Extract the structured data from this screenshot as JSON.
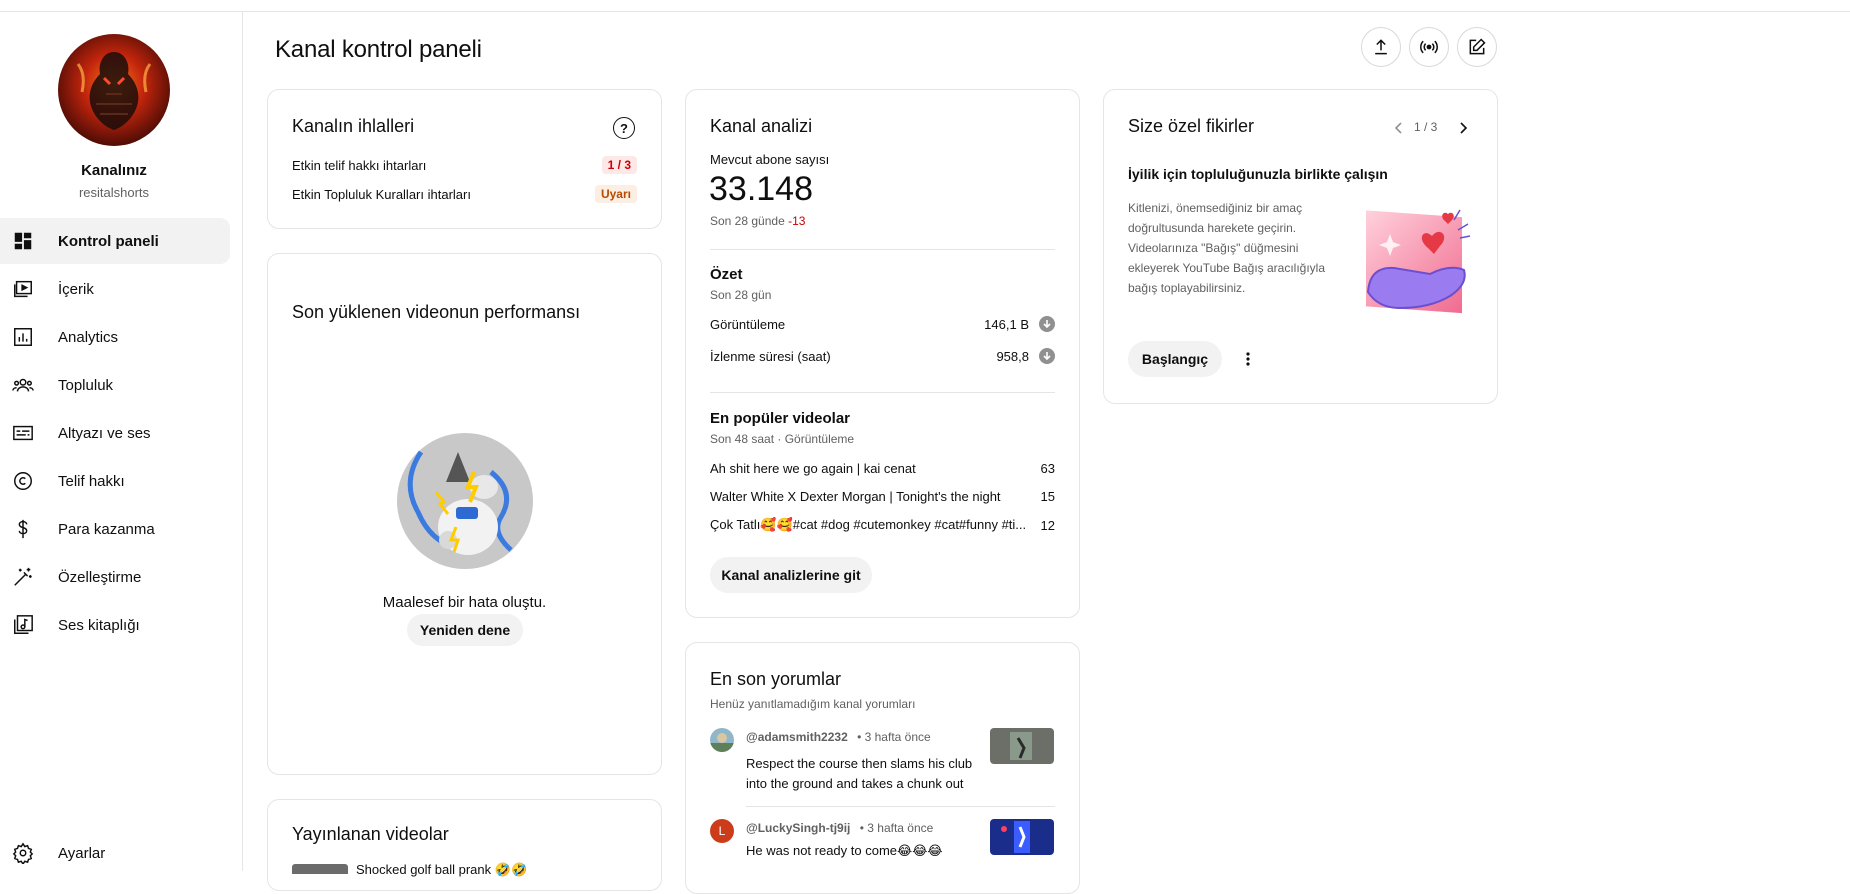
{
  "colors": {
    "red_text": "#cc0000",
    "badge_red_bg": "#fde8e8",
    "badge_orange_bg": "#fdeee4",
    "badge_orange_text": "#b84a00",
    "accent_blue": "#065fd4"
  },
  "sidebar": {
    "channel_title": "Kanalınız",
    "channel_handle": "resitalshorts",
    "items": [
      {
        "label": "Kontrol paneli",
        "icon": "dashboard-icon",
        "active": true
      },
      {
        "label": "İçerik",
        "icon": "content-icon"
      },
      {
        "label": "Analytics",
        "icon": "analytics-icon"
      },
      {
        "label": "Topluluk",
        "icon": "community-icon"
      },
      {
        "label": "Altyazı ve ses",
        "icon": "subtitles-icon"
      },
      {
        "label": "Telif hakkı",
        "icon": "copyright-icon"
      },
      {
        "label": "Para kazanma",
        "icon": "monetization-icon"
      },
      {
        "label": "Özelleştirme",
        "icon": "customization-icon"
      },
      {
        "label": "Ses kitaplığı",
        "icon": "audio-library-icon"
      }
    ],
    "settings_label": "Ayarlar"
  },
  "header": {
    "title": "Kanal kontrol paneli",
    "buttons": [
      "upload-icon",
      "live-icon",
      "create-post-icon"
    ]
  },
  "violations": {
    "title": "Kanalın ihlalleri",
    "rows": [
      {
        "label": "Etkin telif hakkı ihtarları",
        "badge": "1 / 3"
      },
      {
        "label": "Etkin Topluluk Kuralları ihtarları",
        "badge": "Uyarı"
      }
    ]
  },
  "latest_video": {
    "title": "Son yüklenen videonun performansı",
    "error": "Maalesef bir hata oluştu.",
    "retry": "Yeniden dene"
  },
  "published": {
    "title": "Yayınlanan videolar",
    "first_video": "Shocked golf ball prank 🤣🤣"
  },
  "analytics": {
    "title": "Kanal analizi",
    "subscribers_label": "Mevcut abone sayısı",
    "subscribers": "33.148",
    "change_prefix": "Son 28 günde ",
    "change_value": "-13",
    "summary_title": "Özet",
    "summary_period": "Son 28 gün",
    "metrics": [
      {
        "label": "Görüntüleme",
        "value": "146,1 B"
      },
      {
        "label": "İzlenme süresi (saat)",
        "value": "958,8"
      }
    ],
    "top_videos_title": "En popüler videolar",
    "top_videos_period": "Son 48 saat · Görüntüleme",
    "top_videos": [
      {
        "title": "Ah shit here we go again | kai cenat",
        "views": "63"
      },
      {
        "title": "Walter White X Dexter Morgan | Tonight's the night",
        "views": "15"
      },
      {
        "title": "Çok Tatlı🥰🥰#cat #dog #cutemonkey #cat#funny #ti...",
        "views": "12"
      }
    ],
    "cta": "Kanal analizlerine git"
  },
  "comments": {
    "title": "En son yorumlar",
    "subtitle": "Henüz yanıtlamadığım kanal yorumları",
    "items": [
      {
        "author": "@adamsmith2232",
        "time": "• 3 hafta önce",
        "text_line1": "Respect the course then slams his club",
        "text_line2": "into the ground and takes a chunk out"
      },
      {
        "author": "@LuckySingh-tj9ij",
        "time": "• 3 hafta önce",
        "text_line1": "He was not ready to come😂😂😂",
        "avatar_letter": "L"
      }
    ]
  },
  "ideas": {
    "title": "Size özel fikirler",
    "pager": "1 / 3",
    "headline": "İyilik için topluluğunuzla birlikte çalışın",
    "body": "Kitlenizi, önemsediğiniz bir amaç doğrultusunda harekete geçirin. Videolarınıza \"Bağış\" düğmesini ekleyerek YouTube Bağış aracılığıyla bağış toplayabilirsiniz.",
    "cta": "Başlangıç"
  }
}
